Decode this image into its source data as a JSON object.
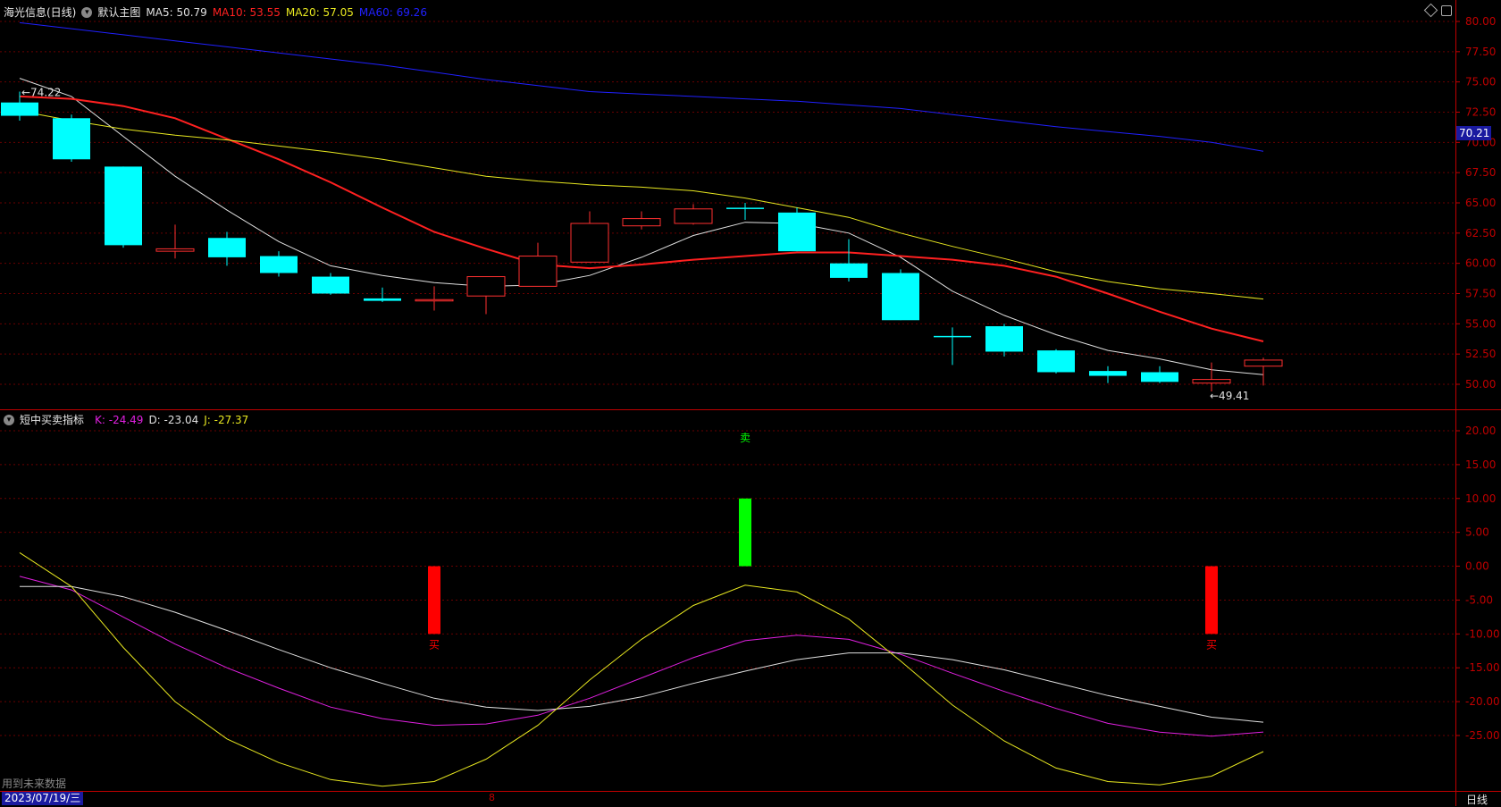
{
  "top_header": {
    "stock_name": "海光信息(日线)",
    "template": "默认主图",
    "ma5": {
      "label": "MA5: 50.79",
      "color": "#e0e0e0"
    },
    "ma10": {
      "label": "MA10: 53.55",
      "color": "#ff2020"
    },
    "ma20": {
      "label": "MA20: 57.05",
      "color": "#e8e820"
    },
    "ma60": {
      "label": "MA60: 69.26",
      "color": "#2020ff"
    }
  },
  "bottom_header": {
    "indicator_name": "短中买卖指标",
    "k": {
      "label": "K: -24.49",
      "color": "#e020e0"
    },
    "d": {
      "label": "D: -23.04",
      "color": "#e0e0e0"
    },
    "j": {
      "label": "J: -27.37",
      "color": "#e8e820"
    }
  },
  "footer": {
    "future_data": "用到未来数据",
    "date": "2023/07/19/三",
    "month_marker": "8",
    "period_button": "日线"
  },
  "price_tag": "70.21",
  "chart_data": [
    {
      "type": "candlestick",
      "title": "海光信息(日线)",
      "ylim": [
        48.5,
        81.5
      ],
      "yticks": [
        "80.00",
        "77.50",
        "75.00",
        "72.50",
        "70.00",
        "67.50",
        "65.00",
        "62.50",
        "60.00",
        "57.50",
        "55.00",
        "52.50",
        "50.00"
      ],
      "high_annotation": "74.22",
      "low_annotation": "49.41",
      "candles": [
        {
          "o": 73.3,
          "c": 72.2,
          "h": 74.2,
          "l": 71.8
        },
        {
          "o": 72.0,
          "c": 68.6,
          "h": 72.3,
          "l": 68.4
        },
        {
          "o": 68.0,
          "c": 61.5,
          "h": 68.0,
          "l": 61.3
        },
        {
          "o": 61.0,
          "c": 61.2,
          "h": 63.2,
          "l": 60.4
        },
        {
          "o": 62.1,
          "c": 60.5,
          "h": 62.6,
          "l": 59.8
        },
        {
          "o": 60.6,
          "c": 59.2,
          "h": 61.0,
          "l": 58.9
        },
        {
          "o": 58.9,
          "c": 57.5,
          "h": 59.2,
          "l": 57.4
        },
        {
          "o": 57.1,
          "c": 56.9,
          "h": 58.0,
          "l": 56.8
        },
        {
          "o": 57.0,
          "c": 57.0,
          "h": 58.1,
          "l": 56.1
        },
        {
          "o": 57.3,
          "c": 58.9,
          "h": 58.9,
          "l": 55.8
        },
        {
          "o": 58.1,
          "c": 60.6,
          "h": 61.7,
          "l": 58.1
        },
        {
          "o": 60.1,
          "c": 63.3,
          "h": 64.3,
          "l": 60.1
        },
        {
          "o": 63.1,
          "c": 63.7,
          "h": 64.3,
          "l": 62.8
        },
        {
          "o": 63.3,
          "c": 64.5,
          "h": 64.9,
          "l": 63.2
        },
        {
          "o": 64.6,
          "c": 64.5,
          "h": 65.0,
          "l": 63.6
        },
        {
          "o": 64.2,
          "c": 61.0,
          "h": 64.6,
          "l": 61.0
        },
        {
          "o": 60.0,
          "c": 58.8,
          "h": 62.0,
          "l": 58.5
        },
        {
          "o": 59.2,
          "c": 55.3,
          "h": 59.5,
          "l": 55.3
        },
        {
          "o": 54.0,
          "c": 53.9,
          "h": 54.7,
          "l": 51.6
        },
        {
          "o": 54.8,
          "c": 52.7,
          "h": 55.0,
          "l": 52.3
        },
        {
          "o": 52.8,
          "c": 51.0,
          "h": 52.9,
          "l": 50.9
        },
        {
          "o": 51.1,
          "c": 50.7,
          "h": 51.5,
          "l": 50.1
        },
        {
          "o": 51.0,
          "c": 50.2,
          "h": 51.5,
          "l": 50.1
        },
        {
          "o": 50.1,
          "c": 50.4,
          "h": 51.8,
          "l": 49.41
        },
        {
          "o": 51.5,
          "c": 52.0,
          "h": 52.2,
          "l": 49.9
        }
      ],
      "series": [
        {
          "name": "MA5",
          "color": "#e0e0e0",
          "values": [
            75.3,
            73.8,
            70.5,
            67.2,
            64.4,
            61.8,
            59.8,
            59.0,
            58.4,
            58.1,
            58.2,
            59.0,
            60.5,
            62.3,
            63.4,
            63.3,
            62.5,
            60.5,
            57.7,
            55.7,
            54.1,
            52.8,
            52.1,
            51.2,
            50.8
          ]
        },
        {
          "name": "MA10",
          "color": "#ff2020",
          "values": [
            73.8,
            73.6,
            73.0,
            72.0,
            70.3,
            68.6,
            66.7,
            64.6,
            62.6,
            61.2,
            59.9,
            59.6,
            59.9,
            60.3,
            60.6,
            60.9,
            60.9,
            60.6,
            60.3,
            59.8,
            58.9,
            57.5,
            56.0,
            54.6,
            53.55
          ]
        },
        {
          "name": "MA20",
          "color": "#e8e820",
          "values": [
            72.6,
            71.8,
            71.1,
            70.6,
            70.2,
            69.7,
            69.2,
            68.6,
            67.9,
            67.2,
            66.8,
            66.5,
            66.3,
            66.0,
            65.4,
            64.6,
            63.8,
            62.5,
            61.4,
            60.4,
            59.3,
            58.5,
            57.9,
            57.5,
            57.05
          ]
        },
        {
          "name": "MA60",
          "color": "#2020ff",
          "values": [
            79.9,
            79.4,
            78.9,
            78.4,
            77.9,
            77.4,
            76.9,
            76.4,
            75.8,
            75.2,
            74.7,
            74.2,
            74.0,
            73.8,
            73.6,
            73.4,
            73.1,
            72.8,
            72.3,
            71.8,
            71.3,
            70.9,
            70.5,
            70.0,
            69.26
          ]
        }
      ]
    },
    {
      "type": "line",
      "title": "短中买卖指标",
      "ylim": [
        -33.5,
        22.5
      ],
      "yticks": [
        "20.00",
        "15.00",
        "10.00",
        "5.00",
        "0.00",
        "-5.00",
        "-10.00",
        "-15.00",
        "-20.00",
        "-25.00"
      ],
      "series": [
        {
          "name": "K",
          "color": "#e020e0",
          "values": [
            -1.5,
            -3.5,
            -7.5,
            -11.5,
            -15.0,
            -18.0,
            -20.8,
            -22.5,
            -23.5,
            -23.3,
            -22.0,
            -19.5,
            -16.5,
            -13.5,
            -11.0,
            -10.2,
            -10.8,
            -13.0,
            -15.8,
            -18.5,
            -21.0,
            -23.2,
            -24.5,
            -25.1,
            -24.49
          ]
        },
        {
          "name": "D",
          "color": "#e0e0e0",
          "values": [
            -3.0,
            -3.0,
            -4.5,
            -6.8,
            -9.5,
            -12.3,
            -15.0,
            -17.3,
            -19.5,
            -20.8,
            -21.3,
            -20.7,
            -19.3,
            -17.3,
            -15.5,
            -13.8,
            -12.8,
            -12.8,
            -13.8,
            -15.3,
            -17.2,
            -19.1,
            -20.7,
            -22.3,
            -23.04
          ]
        },
        {
          "name": "J",
          "color": "#e8e820",
          "values": [
            2.0,
            -3.0,
            -12.0,
            -20.0,
            -25.5,
            -29.0,
            -31.5,
            -32.5,
            -31.8,
            -28.5,
            -23.5,
            -16.8,
            -10.8,
            -5.8,
            -2.8,
            -3.8,
            -7.8,
            -14.0,
            -20.5,
            -25.8,
            -29.8,
            -31.8,
            -32.3,
            -31.0,
            -27.37
          ]
        }
      ],
      "signals": [
        {
          "index": 8,
          "type": "buy",
          "label": "买",
          "from": 0,
          "to": -10,
          "color": "#ff0000"
        },
        {
          "index": 14,
          "type": "sell",
          "label": "卖",
          "from": 0,
          "to": 10,
          "color": "#00ff00"
        },
        {
          "index": 23,
          "type": "buy",
          "label": "买",
          "from": 0,
          "to": -10,
          "color": "#ff0000"
        }
      ]
    }
  ]
}
